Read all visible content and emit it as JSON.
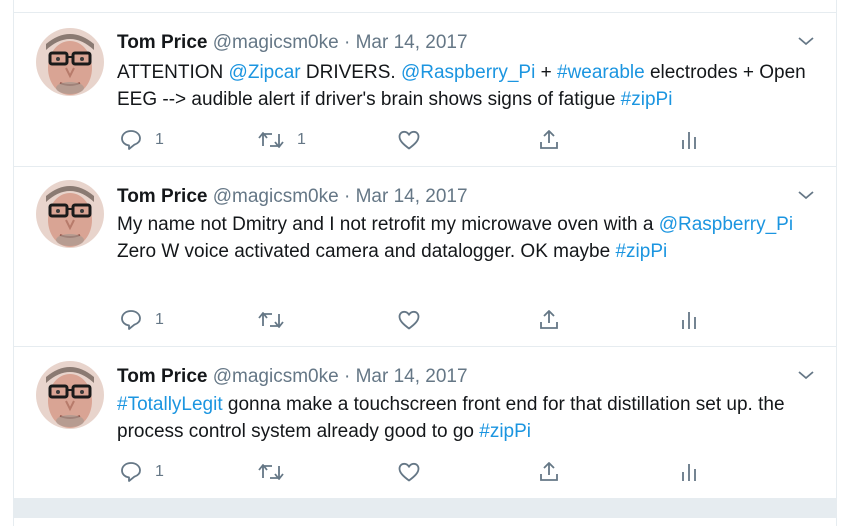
{
  "colors": {
    "link": "#1b95e0",
    "muted": "#657786",
    "text": "#14171a",
    "divider": "#e6ecf0"
  },
  "tweets": [
    {
      "name": "Tom Price",
      "handle": "@magicsm0ke",
      "separator": "·",
      "date": "Mar 14, 2017",
      "segments": [
        {
          "t": "ATTENTION "
        },
        {
          "t": "@Zipcar",
          "link": true
        },
        {
          "t": " DRIVERS. "
        },
        {
          "t": "@Raspberry_Pi",
          "link": true
        },
        {
          "t": " + "
        },
        {
          "t": "#wearable",
          "link": true
        },
        {
          "t": " electrodes + Open EEG --> audible alert if driver's brain shows signs of fatigue "
        },
        {
          "t": "#zipPi",
          "link": true
        }
      ],
      "reply_count": "1",
      "retweet_count": "1",
      "like_count": ""
    },
    {
      "name": "Tom Price",
      "handle": "@magicsm0ke",
      "separator": "·",
      "date": "Mar 14, 2017",
      "segments": [
        {
          "t": "My name not Dmitry and I not retrofit my microwave oven with a "
        },
        {
          "t": "@Raspberry_Pi",
          "link": true
        },
        {
          "t": " Zero W voice activated camera and datalogger. OK maybe "
        },
        {
          "t": "#zipPi",
          "link": true
        }
      ],
      "reply_count": "1",
      "retweet_count": "",
      "like_count": ""
    },
    {
      "name": "Tom Price",
      "handle": "@magicsm0ke",
      "separator": "·",
      "date": "Mar 14, 2017",
      "segments": [
        {
          "t": "#TotallyLegit",
          "link": true
        },
        {
          "t": " gonna make a touchscreen front end for that distillation set up. the process control system already good to go "
        },
        {
          "t": "#zipPi",
          "link": true
        }
      ],
      "reply_count": "1",
      "retweet_count": "",
      "like_count": ""
    }
  ],
  "icons": {
    "caret": "chevron-down-icon",
    "reply": "reply-icon",
    "retweet": "retweet-icon",
    "like": "heart-icon",
    "share": "share-icon",
    "analytics": "analytics-icon"
  }
}
